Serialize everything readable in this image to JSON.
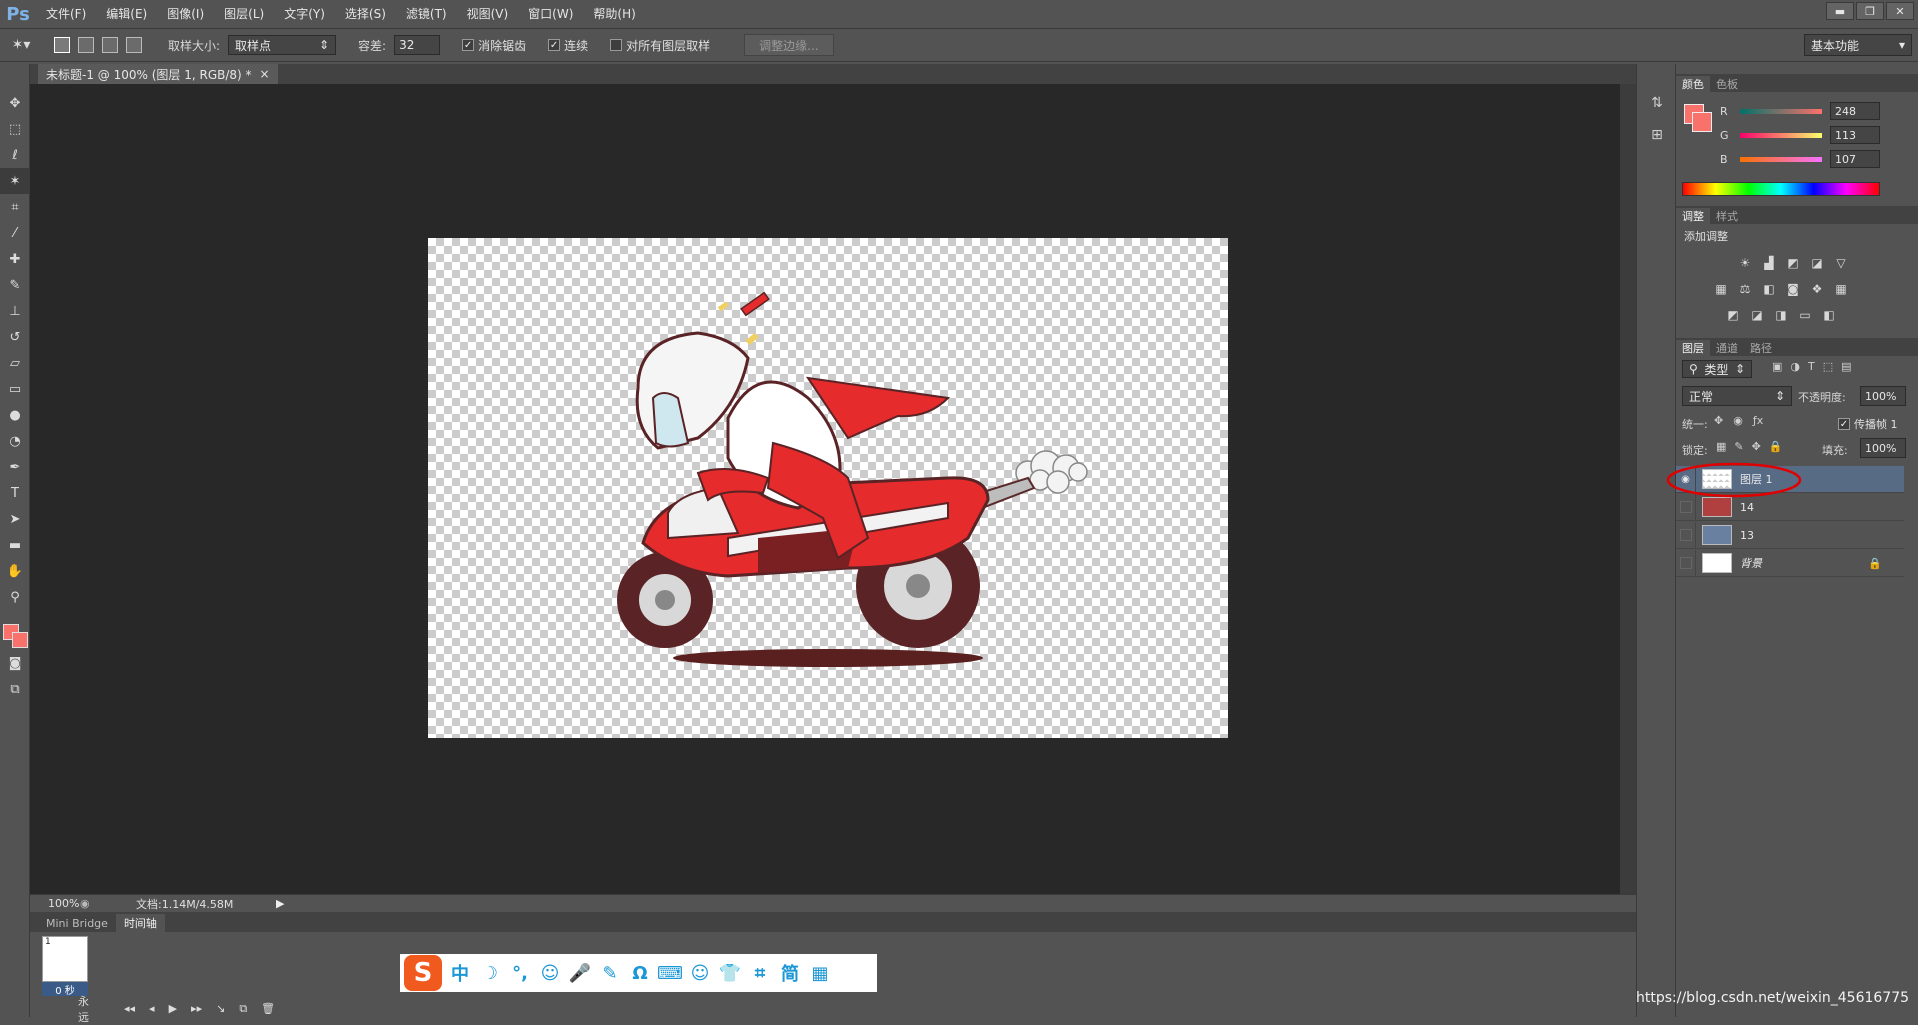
{
  "app": {
    "logo": "Ps"
  },
  "menu": [
    "文件(F)",
    "编辑(E)",
    "图像(I)",
    "图层(L)",
    "文字(Y)",
    "选择(S)",
    "滤镜(T)",
    "视图(V)",
    "窗口(W)",
    "帮助(H)"
  ],
  "window_controls": {
    "minimize": "▬",
    "restore": "❐",
    "close": "✕"
  },
  "options": {
    "sample_size_label": "取样大小:",
    "sample_size_value": "取样点",
    "tolerance_label": "容差:",
    "tolerance_value": "32",
    "antialias_label": "消除锯齿",
    "antialias_checked": true,
    "contiguous_label": "连续",
    "contiguous_checked": true,
    "all_layers_label": "对所有图层取样",
    "all_layers_checked": false,
    "refine_edge_button": "调整边缘...",
    "workspace": "基本功能"
  },
  "document": {
    "tab_title": "未标题-1 @ 100% (图层 1, RGB/8) *",
    "tab_close": "×",
    "zoom": "100%",
    "doc_info": "文档:1.14M/4.58M"
  },
  "bottom_panel": {
    "tabs": [
      "Mini Bridge",
      "时间轴"
    ],
    "frame_number": "1",
    "frame_time": "0 秒",
    "loop": "永远"
  },
  "ime": {
    "logo": "S",
    "icons": [
      "中",
      "☽",
      "°,",
      "☺",
      "🎤",
      "✎",
      "Ω",
      "⌨",
      "☺",
      "👕",
      "⌗",
      "简",
      "▦"
    ]
  },
  "color_panel": {
    "tabs": [
      "颜色",
      "色板"
    ],
    "foreground": "#f8716b",
    "r_label": "R",
    "r_value": "248",
    "g_label": "G",
    "g_value": "113",
    "b_label": "B",
    "b_value": "107"
  },
  "adjustments_panel": {
    "tabs": [
      "调整",
      "样式"
    ],
    "title": "添加调整"
  },
  "layers_panel": {
    "tabs": [
      "图层",
      "通道",
      "路径"
    ],
    "filter_kind": "类型",
    "blend_mode": "正常",
    "opacity_label": "不透明度:",
    "opacity_value": "100%",
    "unify_label": "统一:",
    "propagate_label": "传播帧 1",
    "lock_label": "锁定:",
    "fill_label": "填充:",
    "fill_value": "100%",
    "layers": [
      {
        "name": "图层 1",
        "visible": true,
        "selected": true
      },
      {
        "name": "14",
        "visible": false,
        "selected": false
      },
      {
        "name": "13",
        "visible": false,
        "selected": false
      },
      {
        "name": "背景",
        "visible": false,
        "selected": false,
        "locked": true
      }
    ]
  },
  "watermark": "https://blog.csdn.net/weixin_45616775"
}
